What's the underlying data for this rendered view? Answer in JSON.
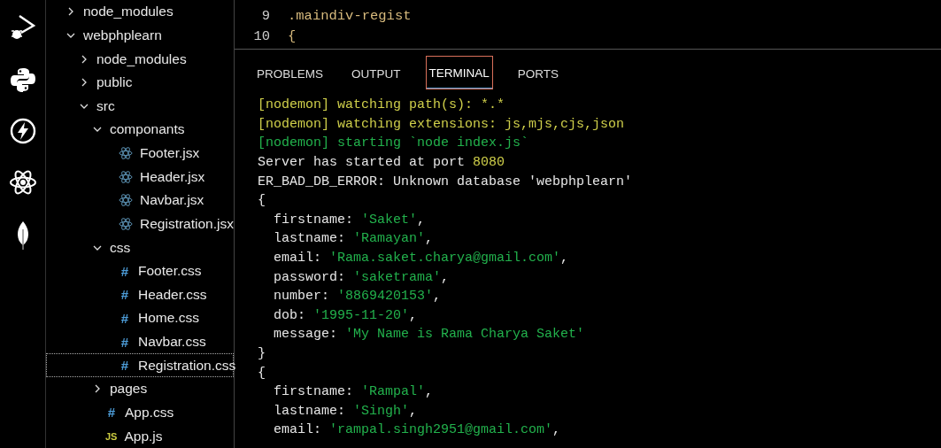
{
  "activity_bar": {
    "items": [
      {
        "kind": "run-debug"
      },
      {
        "kind": "python"
      },
      {
        "kind": "bolt"
      },
      {
        "kind": "react"
      },
      {
        "kind": "leaf"
      }
    ]
  },
  "explorer": {
    "items": [
      {
        "label": "node_modules",
        "kind": "folder",
        "expanded": false,
        "selected": false
      },
      {
        "label": "webphplearn",
        "kind": "folder",
        "expanded": true,
        "selected": false,
        "children": [
          {
            "label": "node_modules",
            "kind": "folder",
            "expanded": false,
            "selected": false
          },
          {
            "label": "public",
            "kind": "folder",
            "expanded": false,
            "selected": false
          },
          {
            "label": "src",
            "kind": "folder",
            "expanded": true,
            "selected": false,
            "children": [
              {
                "label": "componants",
                "kind": "folder",
                "expanded": true,
                "selected": false,
                "children": [
                  {
                    "label": "Footer.jsx",
                    "kind": "react",
                    "selected": false
                  },
                  {
                    "label": "Header.jsx",
                    "kind": "react",
                    "selected": false
                  },
                  {
                    "label": "Navbar.jsx",
                    "kind": "react",
                    "selected": false
                  },
                  {
                    "label": "Registration.jsx",
                    "kind": "react",
                    "selected": false
                  }
                ]
              },
              {
                "label": "css",
                "kind": "folder",
                "expanded": true,
                "selected": false,
                "children": [
                  {
                    "label": "Footer.css",
                    "kind": "css",
                    "icon": "#",
                    "selected": false
                  },
                  {
                    "label": "Header.css",
                    "kind": "css",
                    "icon": "#",
                    "selected": false
                  },
                  {
                    "label": "Home.css",
                    "kind": "css",
                    "icon": "#",
                    "selected": false
                  },
                  {
                    "label": "Navbar.css",
                    "kind": "css",
                    "icon": "#",
                    "selected": false
                  },
                  {
                    "label": "Registration.css",
                    "kind": "css",
                    "icon": "#",
                    "selected": true
                  }
                ]
              },
              {
                "label": "pages",
                "kind": "folder",
                "expanded": false,
                "selected": false
              },
              {
                "label": "App.css",
                "kind": "css",
                "icon": "#",
                "selected": false
              },
              {
                "label": "App.js",
                "kind": "js",
                "icon": "JS",
                "selected": false
              }
            ]
          }
        ]
      }
    ]
  },
  "editor": {
    "lines": [
      {
        "number": "9",
        "text": ".maindiv-regist"
      },
      {
        "number": "10",
        "text": "{"
      }
    ]
  },
  "panel": {
    "tabs": [
      {
        "label": "PROBLEMS",
        "selected": false
      },
      {
        "label": "OUTPUT",
        "selected": false
      },
      {
        "label": "TERMINAL",
        "selected": true
      },
      {
        "label": "PORTS",
        "selected": false
      }
    ],
    "terminal": {
      "lines": [
        [
          {
            "text": "[nodemon] watching path(s): *.*",
            "kind": "log"
          }
        ],
        [
          {
            "text": "[nodemon] watching extensions: js,mjs,cjs,json",
            "kind": "log"
          }
        ],
        [
          {
            "text": "[nodemon] starting `node index.js`",
            "kind": "start"
          }
        ],
        [
          {
            "text": "Server has started at port ",
            "kind": "plain"
          },
          {
            "text": "8080",
            "kind": "number"
          }
        ],
        [
          {
            "text": "ER_BAD_DB_ERROR: Unknown database 'webphplearn'",
            "kind": "plain"
          }
        ],
        [
          {
            "text": "{",
            "kind": "plain"
          }
        ],
        [
          {
            "text": "  firstname: ",
            "kind": "plain"
          },
          {
            "text": "'Saket'",
            "kind": "string"
          },
          {
            "text": ",",
            "kind": "plain"
          }
        ],
        [
          {
            "text": "  lastname: ",
            "kind": "plain"
          },
          {
            "text": "'Ramayan'",
            "kind": "string"
          },
          {
            "text": ",",
            "kind": "plain"
          }
        ],
        [
          {
            "text": "  email: ",
            "kind": "plain"
          },
          {
            "text": "'Rama.saket.charya@gmail.com'",
            "kind": "string"
          },
          {
            "text": ",",
            "kind": "plain"
          }
        ],
        [
          {
            "text": "  password: ",
            "kind": "plain"
          },
          {
            "text": "'saketrama'",
            "kind": "string"
          },
          {
            "text": ",",
            "kind": "plain"
          }
        ],
        [
          {
            "text": "  number: ",
            "kind": "plain"
          },
          {
            "text": "'8869420153'",
            "kind": "string"
          },
          {
            "text": ",",
            "kind": "plain"
          }
        ],
        [
          {
            "text": "  dob: ",
            "kind": "plain"
          },
          {
            "text": "'1995-11-20'",
            "kind": "string"
          },
          {
            "text": ",",
            "kind": "plain"
          }
        ],
        [
          {
            "text": "  message: ",
            "kind": "plain"
          },
          {
            "text": "'My Name is Rama Charya Saket'",
            "kind": "string"
          }
        ],
        [
          {
            "text": "}",
            "kind": "plain"
          }
        ],
        [
          {
            "text": "{",
            "kind": "plain"
          }
        ],
        [
          {
            "text": "  firstname: ",
            "kind": "plain"
          },
          {
            "text": "'Rampal'",
            "kind": "string"
          },
          {
            "text": ",",
            "kind": "plain"
          }
        ],
        [
          {
            "text": "  lastname: ",
            "kind": "plain"
          },
          {
            "text": "'Singh'",
            "kind": "string"
          },
          {
            "text": ",",
            "kind": "plain"
          }
        ],
        [
          {
            "text": "  email: ",
            "kind": "plain"
          },
          {
            "text": "'rampal.singh2951@gmail.com'",
            "kind": "string"
          },
          {
            "text": ",",
            "kind": "plain"
          }
        ]
      ]
    }
  }
}
